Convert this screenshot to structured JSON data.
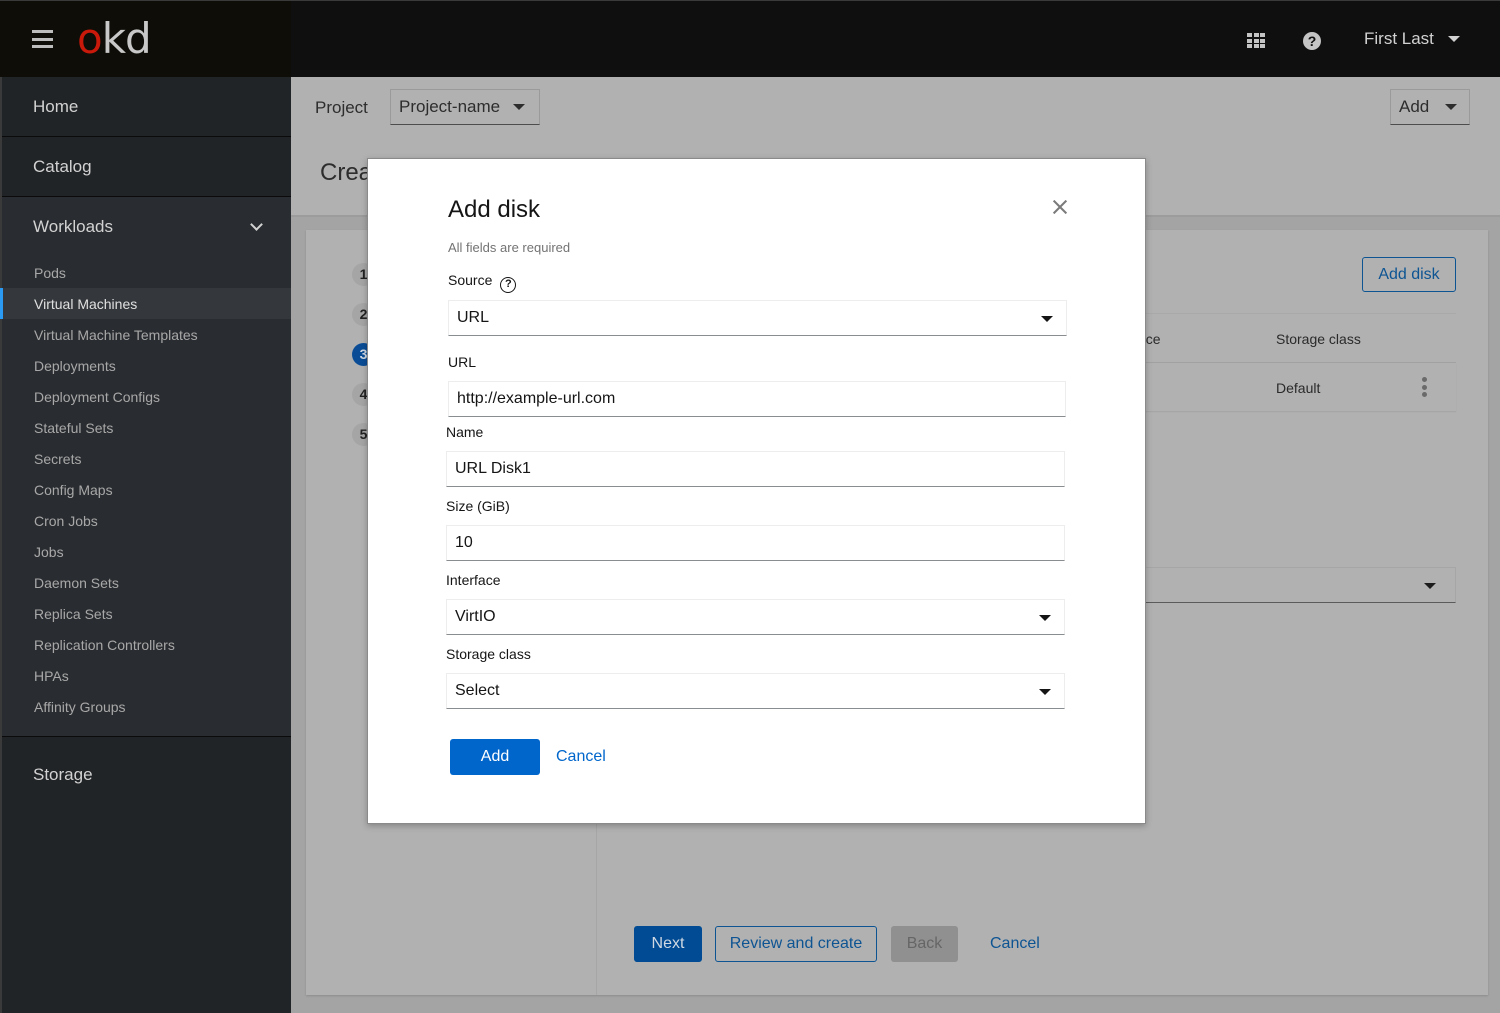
{
  "masthead": {
    "logo_o": "o",
    "logo_kd": "kd",
    "icons": {
      "menu": "hamburger-icon",
      "apps": "app-launcher-grid-icon",
      "help": "help-circle-icon"
    },
    "help_glyph": "?",
    "user_name": "First Last"
  },
  "sidebar": {
    "home": "Home",
    "catalog": "Catalog",
    "workloads": {
      "label": "Workloads",
      "items": [
        {
          "label": "Pods",
          "active": false
        },
        {
          "label": "Virtual Machines",
          "active": true
        },
        {
          "label": "Virtual Machine Templates",
          "active": false
        },
        {
          "label": "Deployments",
          "active": false
        },
        {
          "label": "Deployment Configs",
          "active": false
        },
        {
          "label": "Stateful Sets",
          "active": false
        },
        {
          "label": "Secrets",
          "active": false
        },
        {
          "label": "Config Maps",
          "active": false
        },
        {
          "label": "Cron Jobs",
          "active": false
        },
        {
          "label": "Jobs",
          "active": false
        },
        {
          "label": "Daemon Sets",
          "active": false
        },
        {
          "label": "Replica Sets",
          "active": false
        },
        {
          "label": "Replication Controllers",
          "active": false
        },
        {
          "label": "HPAs",
          "active": false
        },
        {
          "label": "Affinity Groups",
          "active": false
        }
      ]
    },
    "storage": "Storage",
    "active_accent": "#2b9af3"
  },
  "toolbar": {
    "project_label": "Project",
    "project_value": "Project-name",
    "add_label": "Add"
  },
  "page": {
    "title_visible": "Crea"
  },
  "wizard": {
    "steps": [
      "1",
      "2",
      "3",
      "4",
      "5"
    ],
    "current_step": 3,
    "add_disk_label": "Add disk",
    "table": {
      "headers": [
        "ace",
        "Storage class"
      ],
      "rows": [
        {
          "storage_class": "Default"
        }
      ]
    },
    "footer": {
      "next": "Next",
      "review": "Review and create",
      "back": "Back",
      "cancel": "Cancel"
    }
  },
  "modal": {
    "title": "Add disk",
    "note": "All fields are required",
    "source": {
      "label": "Source",
      "value": "URL",
      "help_glyph": "?"
    },
    "url": {
      "label": "URL",
      "value": "http://example-url.com"
    },
    "name": {
      "label": "Name",
      "value": "URL Disk1"
    },
    "size": {
      "label": "Size (GiB)",
      "value": "10"
    },
    "interface": {
      "label": "Interface",
      "value": "VirtIO"
    },
    "storage_class": {
      "label": "Storage class",
      "value": "Select"
    },
    "add_label": "Add",
    "cancel_label": "Cancel",
    "primary_color": "#0066cc"
  }
}
